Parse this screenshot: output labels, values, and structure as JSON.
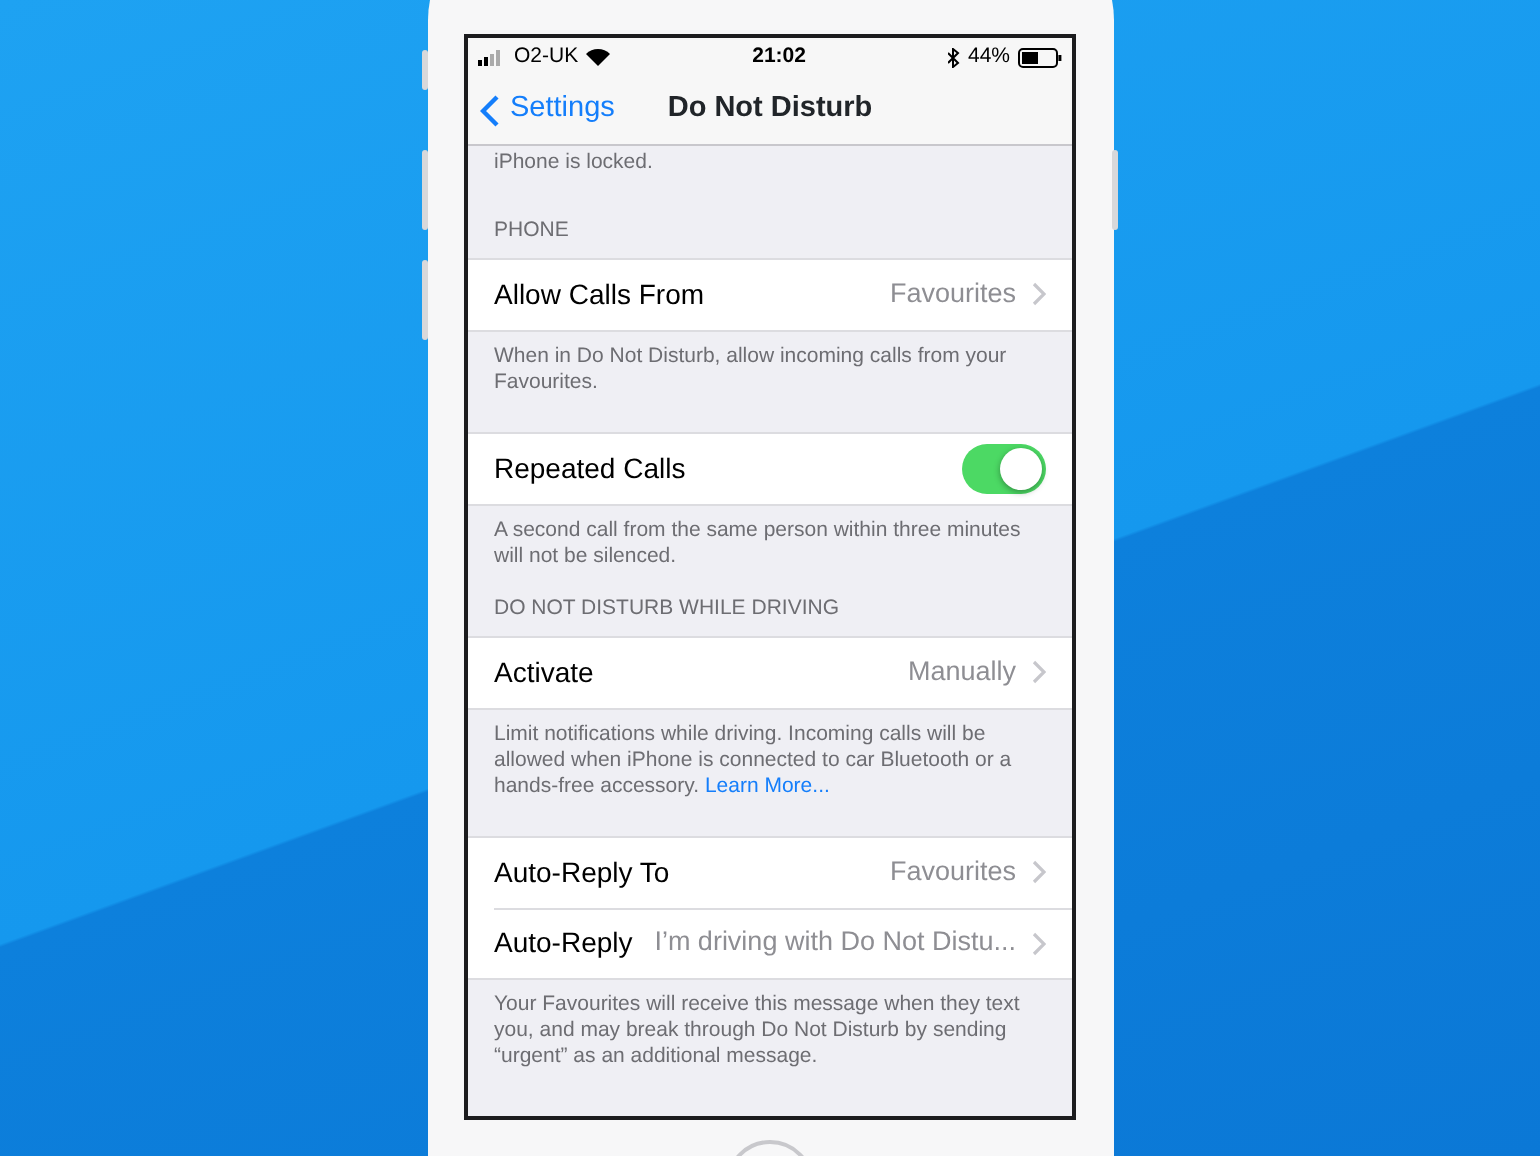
{
  "status_bar": {
    "carrier": "O2-UK",
    "time": "21:02",
    "battery": "44%"
  },
  "nav": {
    "back": "Settings",
    "title": "Do Not Disturb"
  },
  "top_footer": "iPhone is locked.",
  "sections": [
    {
      "header": "PHONE",
      "rows": [
        {
          "kind": "value",
          "label": "Allow Calls From",
          "value": "Favourites"
        }
      ],
      "footer": "When in Do Not Disturb, allow incoming calls from your Favourites."
    },
    {
      "rows": [
        {
          "kind": "toggle",
          "label": "Repeated Calls",
          "on": true
        }
      ],
      "footer": "A second call from the same person within three minutes will not be silenced."
    },
    {
      "header": "DO NOT DISTURB WHILE DRIVING",
      "rows": [
        {
          "kind": "value",
          "label": "Activate",
          "value": "Manually"
        }
      ],
      "footer": "Limit notifications while driving. Incoming calls will be allowed when iPhone is connected to car Bluetooth or a hands-free accessory.",
      "footer_link": "Learn More..."
    },
    {
      "rows": [
        {
          "kind": "value",
          "label": "Auto-Reply To",
          "value": "Favourites"
        },
        {
          "kind": "value",
          "label": "Auto-Reply",
          "value": "I’m driving with Do Not Distu..."
        }
      ],
      "footer": "Your Favourites will receive this message when they text you, and may break through Do Not Disturb by sending “urgent” as an additional message."
    }
  ]
}
